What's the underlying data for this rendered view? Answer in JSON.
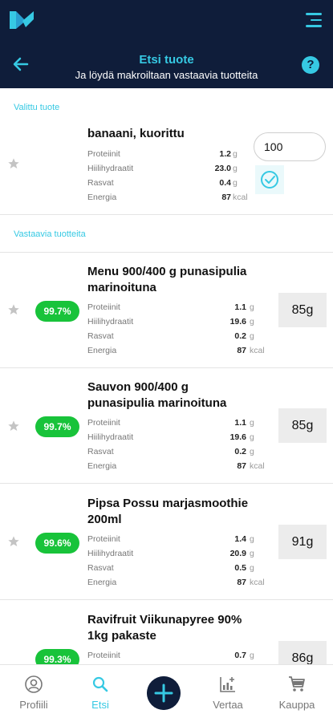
{
  "header": {
    "title": "Etsi tuote",
    "subtitle": "Ja löydä makroiltaan vastaavia tuotteita"
  },
  "selected": {
    "section_label": "Valittu tuote",
    "name": "banaani, kuorittu",
    "quantity": "100",
    "macros": [
      {
        "label": "Proteiinit",
        "value": "1.2",
        "unit": "g"
      },
      {
        "label": "Hiilihydraatit",
        "value": "23.0",
        "unit": "g"
      },
      {
        "label": "Rasvat",
        "value": "0.4",
        "unit": "g"
      },
      {
        "label": "Energia",
        "value": "87",
        "unit": "kcal"
      }
    ]
  },
  "matches": {
    "section_label": "Vastaavia tuotteita",
    "items": [
      {
        "name_lines": [
          "Menu 900/400 g punasipulia",
          "marinoituna"
        ],
        "match": "99.7%",
        "grams": "85g",
        "macros": [
          {
            "label": "Proteiinit",
            "value": "1.1",
            "unit": "g"
          },
          {
            "label": "Hiilihydraatit",
            "value": "19.6",
            "unit": "g"
          },
          {
            "label": "Rasvat",
            "value": "0.2",
            "unit": "g"
          },
          {
            "label": "Energia",
            "value": "87",
            "unit": "kcal"
          }
        ]
      },
      {
        "name_lines": [
          "Sauvon 900/400 g",
          "punasipulia marinoituna"
        ],
        "match": "99.7%",
        "grams": "85g",
        "macros": [
          {
            "label": "Proteiinit",
            "value": "1.1",
            "unit": "g"
          },
          {
            "label": "Hiilihydraatit",
            "value": "19.6",
            "unit": "g"
          },
          {
            "label": "Rasvat",
            "value": "0.2",
            "unit": "g"
          },
          {
            "label": "Energia",
            "value": "87",
            "unit": "kcal"
          }
        ]
      },
      {
        "name_lines": [
          "Pipsa Possu marjasmoothie",
          "200ml"
        ],
        "match": "99.6%",
        "grams": "91g",
        "macros": [
          {
            "label": "Proteiinit",
            "value": "1.4",
            "unit": "g"
          },
          {
            "label": "Hiilihydraatit",
            "value": "20.9",
            "unit": "g"
          },
          {
            "label": "Rasvat",
            "value": "0.5",
            "unit": "g"
          },
          {
            "label": "Energia",
            "value": "87",
            "unit": "kcal"
          }
        ]
      },
      {
        "name_lines": [
          "Ravifruit Viikunapyree 90%",
          "1kg pakaste"
        ],
        "match": "99.3%",
        "grams": "86g",
        "macros": [
          {
            "label": "Proteiinit",
            "value": "0.7",
            "unit": "g"
          }
        ]
      }
    ]
  },
  "nav": [
    {
      "label": "Profiili",
      "icon": "profile-icon"
    },
    {
      "label": "Etsi",
      "icon": "search-icon",
      "active": true
    },
    {
      "label": "",
      "icon": "plus-icon"
    },
    {
      "label": "Vertaa",
      "icon": "compare-chart-icon"
    },
    {
      "label": "Kauppa",
      "icon": "cart-icon"
    }
  ],
  "colors": {
    "header_bg": "#0f1d3a",
    "accent": "#36c9e3",
    "match_badge": "#18c33a"
  }
}
